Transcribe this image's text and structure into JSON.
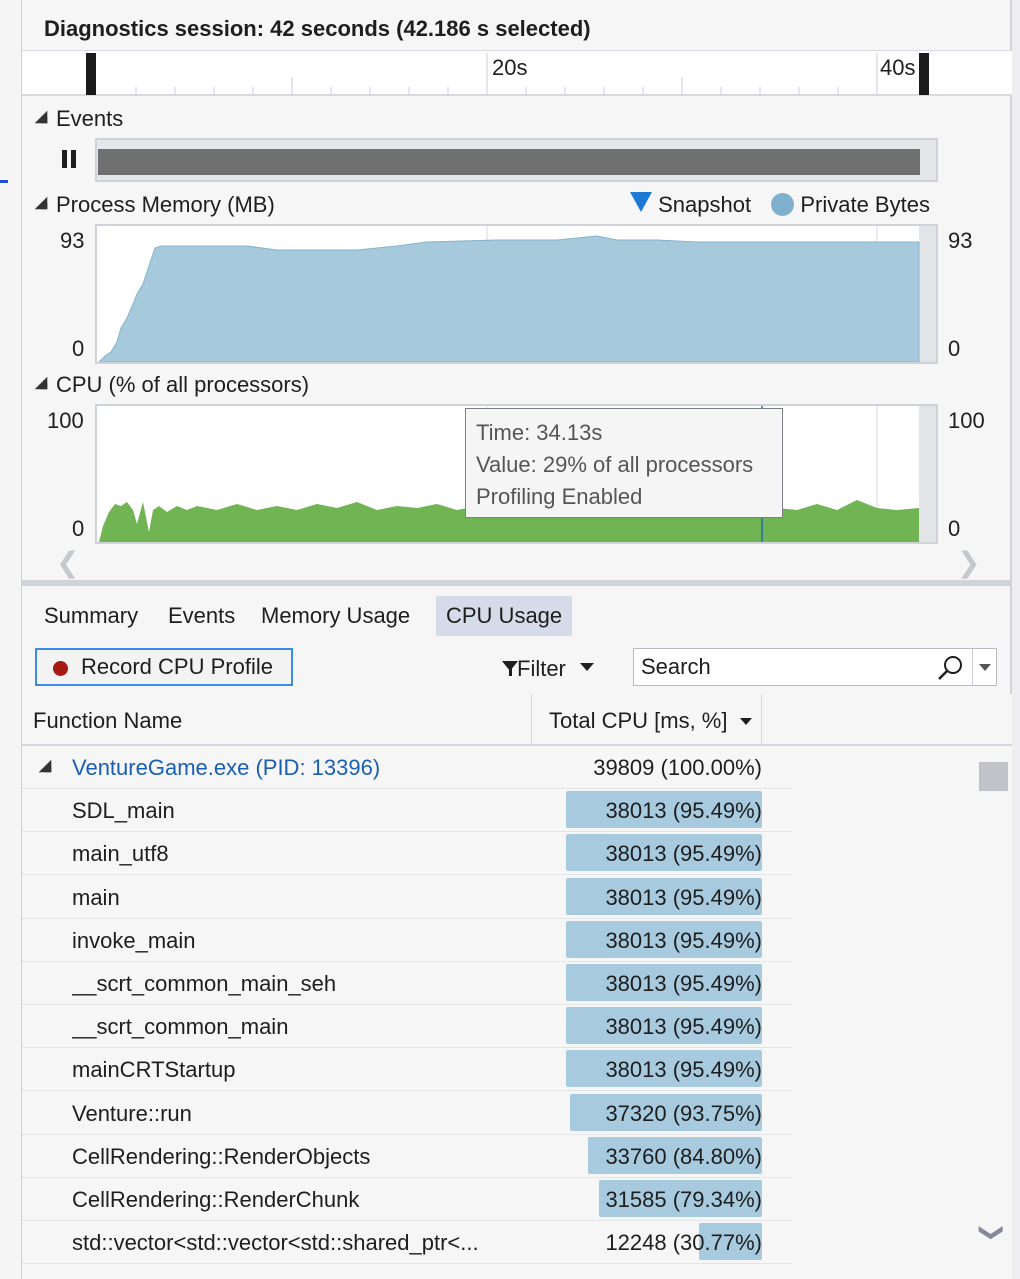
{
  "session": {
    "title": "Diagnostics session: 42 seconds (42.186 s selected)"
  },
  "ruler": {
    "ticks": [
      "20s",
      "40s"
    ]
  },
  "events": {
    "title": "Events"
  },
  "memory": {
    "title": "Process Memory (MB)",
    "legend_snapshot": "Snapshot",
    "legend_private": "Private Bytes",
    "y_max": "93",
    "y_min": "0",
    "colors": {
      "fill": "#a7c9dc",
      "snapshot": "#1e79d4"
    }
  },
  "cpu_graph": {
    "title": "CPU (% of all processors)",
    "y_max": "100",
    "y_min": "0",
    "colors": {
      "fill": "#71b453"
    }
  },
  "tooltip": {
    "time": "Time: 34.13s",
    "value": "Value: 29% of all processors",
    "status": "Profiling Enabled"
  },
  "tabs": [
    {
      "label": "Summary",
      "active": false
    },
    {
      "label": "Events",
      "active": false
    },
    {
      "label": "Memory Usage",
      "active": false
    },
    {
      "label": "CPU Usage",
      "active": true
    }
  ],
  "toolbar": {
    "record_label": "Record CPU Profile",
    "filter_label": "Filter",
    "search_placeholder": "Search"
  },
  "table": {
    "columns": [
      "Function Name",
      "Total CPU [ms, %]"
    ],
    "rows": [
      {
        "name": "VentureGame.exe (PID: 13396)",
        "cpu": "39809 (100.00%)",
        "pct": 100.0,
        "root": true
      },
      {
        "name": "SDL_main",
        "cpu": "38013 (95.49%)",
        "pct": 95.49
      },
      {
        "name": "main_utf8",
        "cpu": "38013 (95.49%)",
        "pct": 95.49
      },
      {
        "name": "main",
        "cpu": "38013 (95.49%)",
        "pct": 95.49
      },
      {
        "name": "invoke_main",
        "cpu": "38013 (95.49%)",
        "pct": 95.49
      },
      {
        "name": "__scrt_common_main_seh",
        "cpu": "38013 (95.49%)",
        "pct": 95.49
      },
      {
        "name": "__scrt_common_main",
        "cpu": "38013 (95.49%)",
        "pct": 95.49
      },
      {
        "name": "mainCRTStartup",
        "cpu": "38013 (95.49%)",
        "pct": 95.49
      },
      {
        "name": "Venture::run",
        "cpu": "37320 (93.75%)",
        "pct": 93.75
      },
      {
        "name": "CellRendering::RenderObjects",
        "cpu": "33760 (84.80%)",
        "pct": 84.8
      },
      {
        "name": "CellRendering::RenderChunk",
        "cpu": "31585 (79.34%)",
        "pct": 79.34
      },
      {
        "name": "std::vector<std::vector<std::shared_ptr<...",
        "cpu": "12248 (30.77%)",
        "pct": 30.77
      }
    ]
  }
}
